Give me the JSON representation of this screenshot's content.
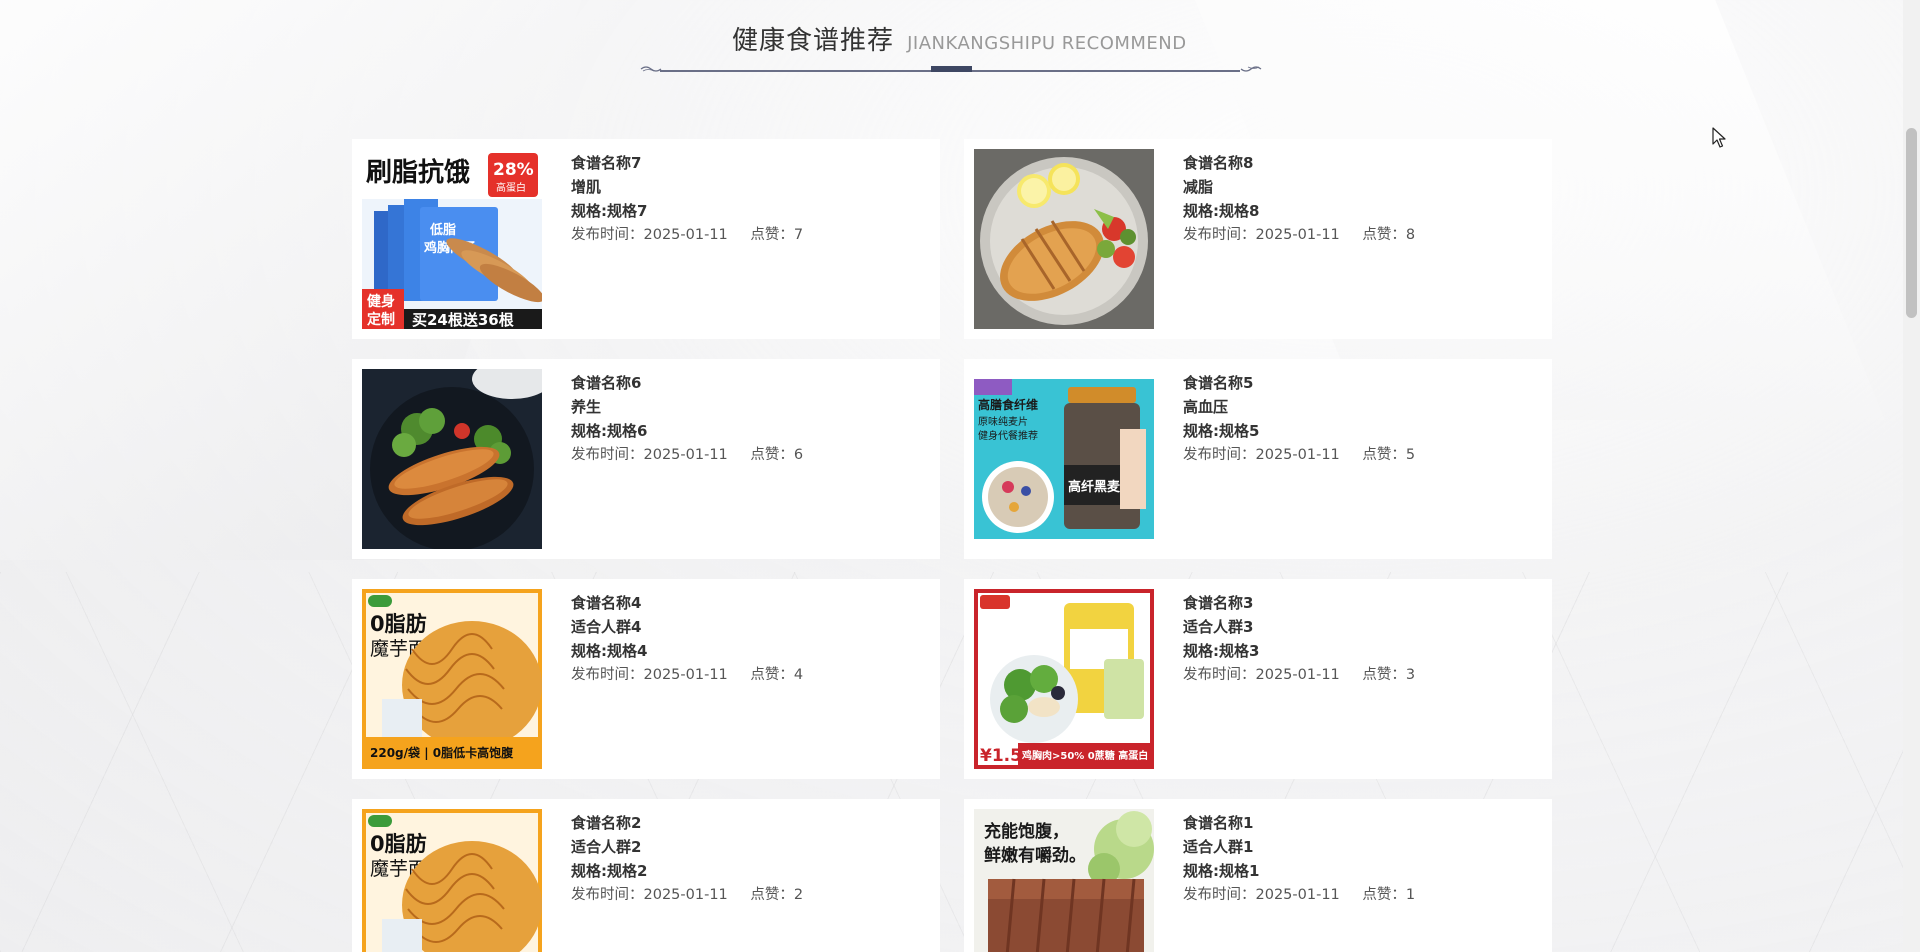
{
  "section": {
    "title_cn": "健康食谱推荐",
    "title_en": "JIANKANGSHIPU RECOMMEND"
  },
  "labels": {
    "publish_time": "发布时间：",
    "likes": "点赞："
  },
  "recipes": [
    {
      "name": "食谱名称7",
      "tag": "增肌",
      "spec": "规格:规格7",
      "date": "2025-01-11",
      "likes": "7",
      "image": "high-protein-chicken-sausage-package",
      "image_text": {
        "l1": "刷脂抗饿",
        "badge_num": "28%",
        "badge_txt": "高蛋白",
        "pack1": "低脂",
        "pack2": "鸡胸肉肠",
        "corner1": "健身",
        "corner2": "定制",
        "promo": "买24根送36根"
      }
    },
    {
      "name": "食谱名称8",
      "tag": "减脂",
      "spec": "规格:规格8",
      "date": "2025-01-11",
      "likes": "8",
      "image": "grilled-chicken-breast-plate"
    },
    {
      "name": "食谱名称6",
      "tag": "养生",
      "spec": "规格:规格6",
      "date": "2025-01-11",
      "likes": "6",
      "image": "sausages-with-broccoli"
    },
    {
      "name": "食谱名称5",
      "tag": "高血压",
      "spec": "规格:规格5",
      "date": "2025-01-11",
      "likes": "5",
      "image": "black-oatmeal-jar",
      "image_text": {
        "l1": "高膳食纤维",
        "l2": "原味纯麦片",
        "l3": "健身代餐推荐",
        "jar": "高纤黑麦片"
      }
    },
    {
      "name": "食谱名称4",
      "tag": "适合人群4",
      "spec": "规格:规格4",
      "date": "2025-01-11",
      "likes": "4",
      "image": "konjac-noodles-package",
      "image_text": {
        "l1": "0脂肪",
        "l2": "魔芋面",
        "bottom": "220g/袋 | 0脂低卡高饱腹"
      }
    },
    {
      "name": "食谱名称3",
      "tag": "适合人群3",
      "spec": "规格:规格3",
      "date": "2025-01-11",
      "likes": "3",
      "image": "chicken-salad-package",
      "image_text": {
        "price": "¥1.59",
        "bottom": "鸡胸肉>50% 0蔗糖 高蛋白"
      }
    },
    {
      "name": "食谱名称2",
      "tag": "适合人群2",
      "spec": "规格:规格2",
      "date": "2025-01-11",
      "likes": "2",
      "image": "konjac-noodles-package",
      "image_text": {
        "l1": "0脂肪",
        "l2": "魔芋面"
      }
    },
    {
      "name": "食谱名称1",
      "tag": "适合人群1",
      "spec": "规格:规格1",
      "date": "2025-01-11",
      "likes": "1",
      "image": "sliced-steak-with-greens",
      "image_text": {
        "l1": "充能饱腹，",
        "l2": "鲜嫩有嚼劲。"
      }
    }
  ],
  "colors": {
    "title_line": "#6a6f87",
    "title_accent": "#3e4763",
    "card_bg": "#ffffff"
  }
}
